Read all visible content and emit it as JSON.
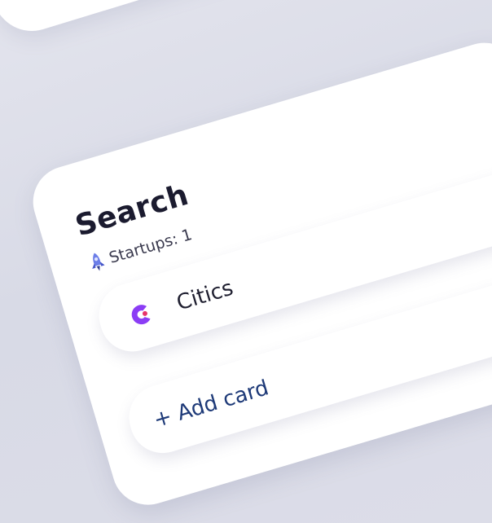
{
  "column": {
    "title": "Search",
    "count_label": "Startups: 1",
    "count_icon": "rocket-icon"
  },
  "items": [
    {
      "name": "Citics",
      "logo_color": "#8b3df5",
      "logo_accent": "#e8336b"
    }
  ],
  "add_card": {
    "label": "+ Add card"
  },
  "colors": {
    "background": "#dcdde8",
    "card": "#ffffff",
    "title": "#1b1b2f",
    "add_text": "#1e3a78",
    "rocket": "#5b6fe0"
  }
}
